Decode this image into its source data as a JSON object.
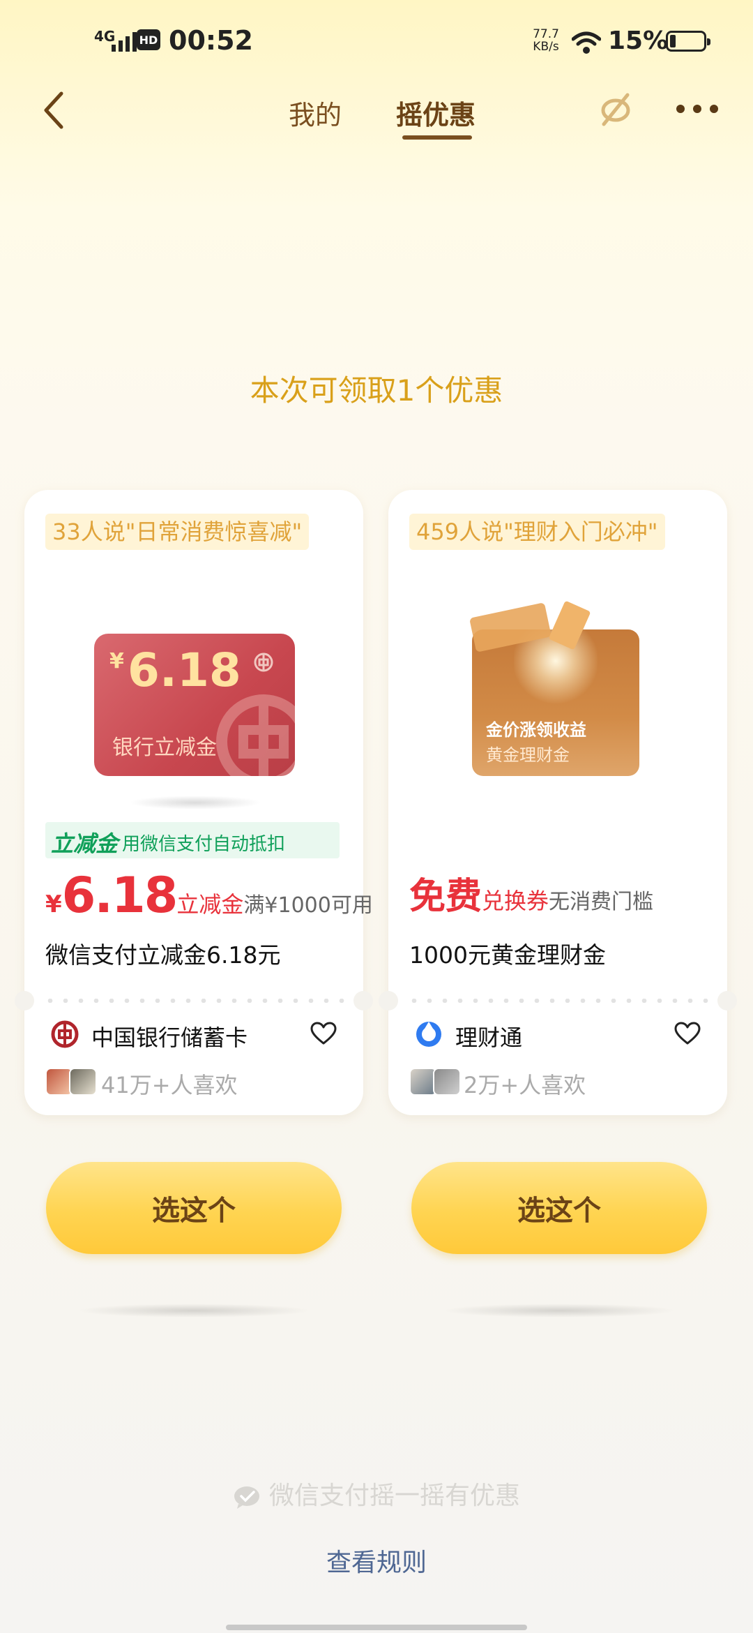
{
  "status_bar": {
    "network": "4G",
    "hd": "HD",
    "time": "00:52",
    "speed_value": "77.7",
    "speed_unit": "KB/s",
    "battery": "15%"
  },
  "nav": {
    "tab_mine": "我的",
    "tab_shake": "摇优惠"
  },
  "headline": "本次可领取1个优惠",
  "cards": [
    {
      "quote": "33人说\"日常消费惊喜减\"",
      "voucher_yen": "¥",
      "voucher_amount": "6.18",
      "voucher_label": "银行立减金",
      "tag_bold": "立减金",
      "tag_text": "用微信支付自动抵扣",
      "price_yen": "¥",
      "price_amount": "6.18",
      "price_unit": "立减金",
      "price_condition": "满¥1000可用",
      "title": "微信支付立减金6.18元",
      "brand": "中国银行储蓄卡",
      "likes": "41万+人喜欢",
      "button": "选这个"
    },
    {
      "quote": "459人说\"理财入门必冲\"",
      "gold_line1": "金价涨领收益",
      "gold_line2": "黄金理财金",
      "price_free": "免费",
      "price_unit": "兑换券",
      "price_condition": "无消费门槛",
      "title": "1000元黄金理财金",
      "brand": "理财通",
      "likes": "2万+人喜欢",
      "button": "选这个"
    }
  ],
  "footer": {
    "wechat_text": "微信支付摇一摇有优惠",
    "rules_link": "查看规则"
  },
  "colors": {
    "accent_brown": "#6b4316",
    "headline_gold": "#d9a01a",
    "price_red": "#e8323b",
    "tag_green": "#10a05a",
    "button_yellow": "#ffd451"
  }
}
